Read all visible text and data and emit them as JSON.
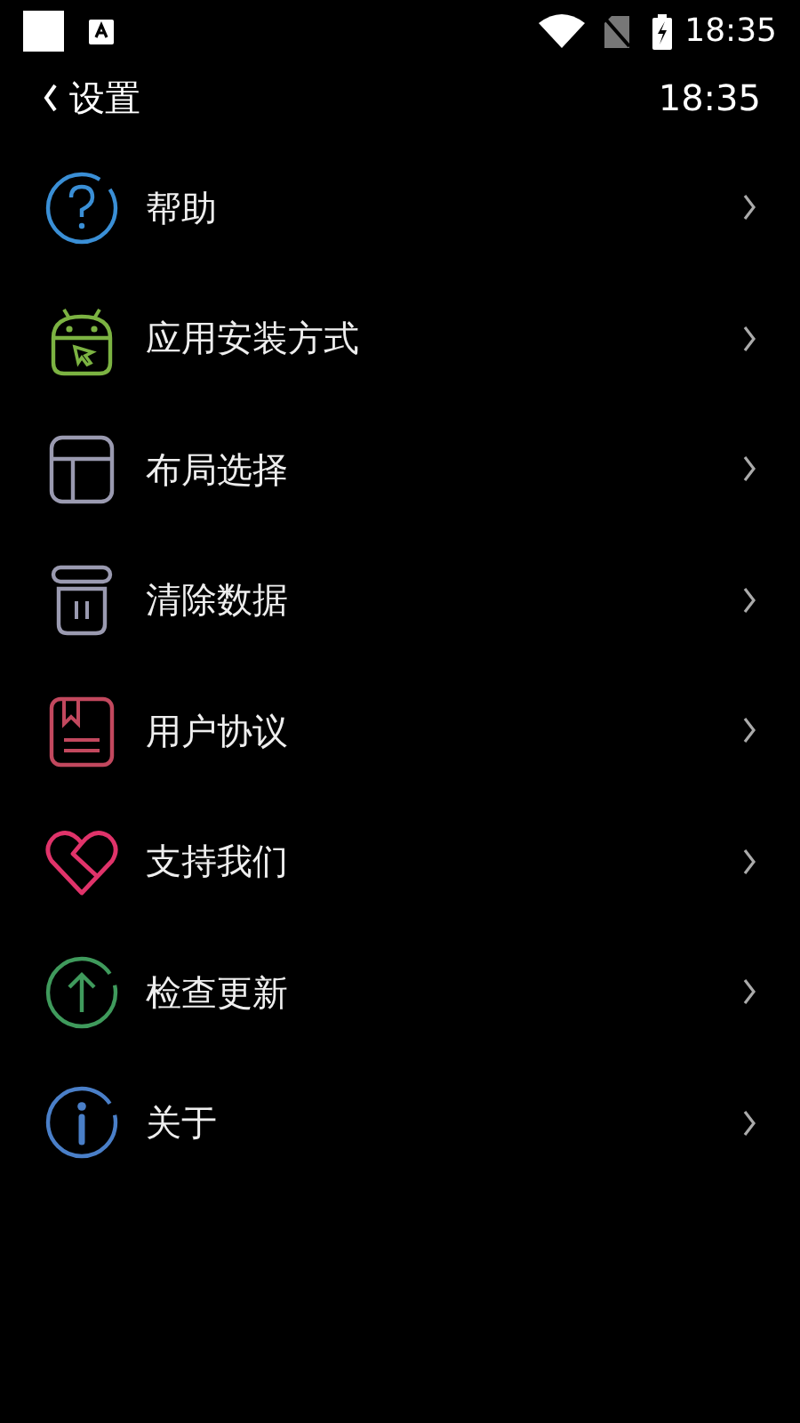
{
  "status_bar": {
    "time": "18:35"
  },
  "header": {
    "title": "设置",
    "time": "18:35"
  },
  "items": [
    {
      "label": "帮助",
      "kind": "help",
      "color": "#3a8fd6"
    },
    {
      "label": "应用安装方式",
      "kind": "android",
      "color": "#7cb342"
    },
    {
      "label": "布局选择",
      "kind": "layout",
      "color": "#9a9ab0"
    },
    {
      "label": "清除数据",
      "kind": "trash",
      "color": "#9a9ab0"
    },
    {
      "label": "用户协议",
      "kind": "document",
      "color": "#c2485e"
    },
    {
      "label": "支持我们",
      "kind": "heart",
      "color": "#e0336a"
    },
    {
      "label": "检查更新",
      "kind": "update",
      "color": "#3f9a5c"
    },
    {
      "label": "关于",
      "kind": "info",
      "color": "#4a7fc8"
    }
  ]
}
